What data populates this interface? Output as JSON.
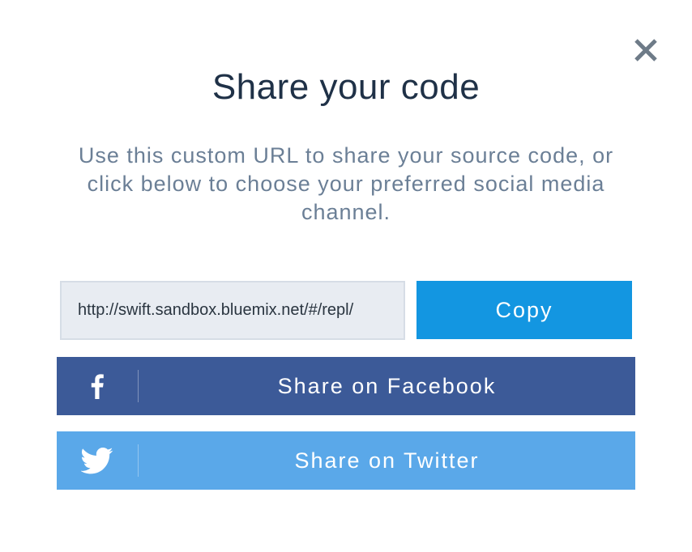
{
  "dialog": {
    "title": "Share your code",
    "description": "Use this custom URL to share your source code, or click below to choose your preferred social media channel."
  },
  "url": {
    "value": "http://swift.sandbox.bluemix.net/#/repl/"
  },
  "buttons": {
    "copy_label": "Copy",
    "facebook_label": "Share on Facebook",
    "twitter_label": "Share on Twitter"
  },
  "icons": {
    "close": "close-icon",
    "facebook": "facebook-icon",
    "twitter": "twitter-icon"
  },
  "colors": {
    "title": "#1f3147",
    "description": "#6b7f96",
    "copy": "#1396e1",
    "facebook": "#3c5a98",
    "twitter": "#5aa8e9",
    "close": "#6e7b88"
  }
}
